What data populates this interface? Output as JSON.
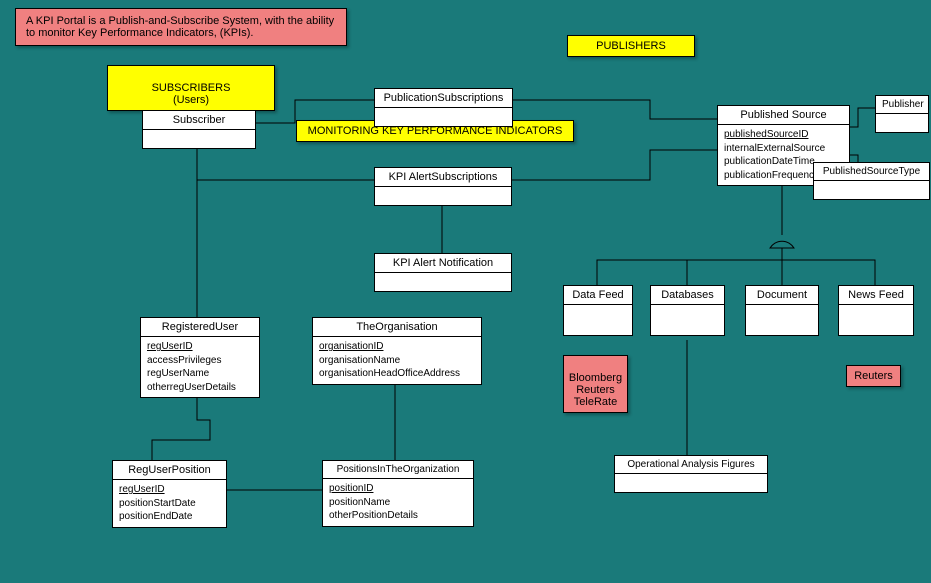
{
  "notes": {
    "description": "A KPI Portal is a Publish-and-Subscribe System, with the ability to monitor Key Performance Indicators, (KPIs).",
    "subscribers": "SUBSCRIBERS\n(Users)",
    "publishers": "PUBLISHERS",
    "monitoring": "MONITORING KEY PERFORMANCE INDICATORS",
    "bloomberg": "Bloomberg\nReuters\nTeleRate",
    "reuters": "Reuters"
  },
  "entities": {
    "subscriber": {
      "title": "Subscriber"
    },
    "publicationSubscriptions": {
      "title": "PublicationSubscriptions"
    },
    "kpiAlertSubscriptions": {
      "title": "KPI AlertSubscriptions"
    },
    "kpiAlertNotification": {
      "title": "KPI Alert Notification"
    },
    "publishedSource": {
      "title": "Published Source",
      "attrs": [
        "publishedSourceID",
        "internalExternalSource",
        "publicationDateTime",
        "publicationFrequency"
      ]
    },
    "publisher": {
      "title": "Publisher"
    },
    "publishedSourceType": {
      "title": "PublishedSourceType"
    },
    "registeredUser": {
      "title": "RegisteredUser",
      "attrs": [
        "regUserID",
        "accessPrivileges",
        "regUserName",
        "otherregUserDetails"
      ]
    },
    "theOrganisation": {
      "title": "TheOrganisation",
      "attrs": [
        "organisationID",
        "organisationName",
        "organisationHeadOfficeAddress"
      ]
    },
    "regUserPosition": {
      "title": "RegUserPosition",
      "attrs": [
        "regUserID",
        "positionStartDate",
        "positionEndDate"
      ]
    },
    "positionsInTheOrganization": {
      "title": "PositionsInTheOrganization",
      "attrs": [
        "positionID",
        "positionName",
        "otherPositionDetails"
      ]
    },
    "dataFeed": {
      "title": "Data Feed"
    },
    "databases": {
      "title": "Databases"
    },
    "document": {
      "title": "Document"
    },
    "newsFeed": {
      "title": "News Feed"
    },
    "operationalAnalysisFigures": {
      "title": "Operational Analysis Figures"
    }
  }
}
